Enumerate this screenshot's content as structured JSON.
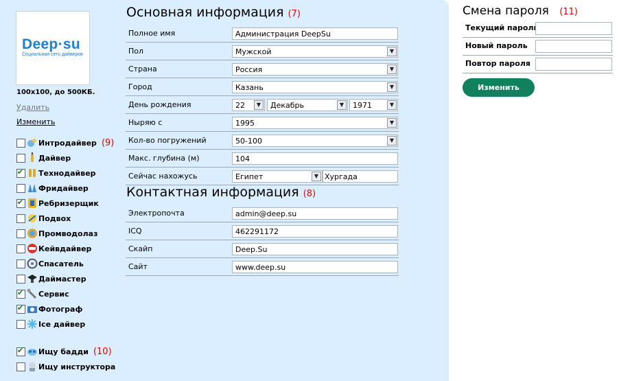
{
  "avatar": {
    "logo_text": "Deep",
    "logo_dot": "·",
    "logo_text2": "su",
    "logo_tagline": "Социальная сеть дайверов",
    "size_note": "100x100, до 500КБ.",
    "delete_label": "Удалить",
    "change_label": "Изменить"
  },
  "specializations": [
    {
      "label": "Интродайвер",
      "checked": false,
      "icon": "intro-diver-icon",
      "mark": "(9)"
    },
    {
      "label": "Дайвер",
      "checked": false,
      "icon": "diver-icon"
    },
    {
      "label": "Технодайвер",
      "checked": true,
      "icon": "tech-diver-icon"
    },
    {
      "label": "Фридайвер",
      "checked": false,
      "icon": "freediver-icon"
    },
    {
      "label": "Ребризерщик",
      "checked": true,
      "icon": "rebreather-icon"
    },
    {
      "label": "Подвох",
      "checked": false,
      "icon": "underwater-hunter-icon"
    },
    {
      "label": "Промводолаз",
      "checked": false,
      "icon": "commercial-diver-icon"
    },
    {
      "label": "Кейвдайвер",
      "checked": false,
      "icon": "cave-diver-icon"
    },
    {
      "label": "Спасатель",
      "checked": false,
      "icon": "rescuer-icon"
    },
    {
      "label": "Даймастер",
      "checked": false,
      "icon": "divemaster-icon"
    },
    {
      "label": "Сервис",
      "checked": true,
      "icon": "service-icon"
    },
    {
      "label": "Фотограф",
      "checked": true,
      "icon": "photographer-icon"
    },
    {
      "label": "Ice дайвер",
      "checked": false,
      "icon": "ice-diver-icon"
    }
  ],
  "seeking": [
    {
      "label": "Ищу бадди",
      "checked": true,
      "icon": "buddy-icon",
      "mark": "(10)"
    },
    {
      "label": "Ищу инструктора",
      "checked": false,
      "icon": "instructor-icon"
    }
  ],
  "basic": {
    "title": "Основная информация",
    "mark": "(7)",
    "full_name_label": "Полное имя",
    "full_name": "Администрация DeepSu",
    "gender_label": "Пол",
    "gender": "Мужской",
    "country_label": "Страна",
    "country": "Россия",
    "city_label": "Город",
    "city": "Казань",
    "birthday_label": "День рождения",
    "birth_day": "22",
    "birth_month": "Декабрь",
    "birth_year": "1971",
    "diving_since_label": "Ныряю с",
    "diving_since": "1995",
    "dives_count_label": "Кол-во погружений",
    "dives_count": "50-100",
    "max_depth_label": "Макс. глубина (м)",
    "max_depth": "104",
    "location_label": "Сейчас нахожусь",
    "location_country": "Египет",
    "location_city": "Хургада"
  },
  "contact": {
    "title": "Контактная информация",
    "mark": "(8)",
    "email_label": "Электропочта",
    "email": "admin@deep.su",
    "icq_label": "ICQ",
    "icq": "462291172",
    "skype_label": "Скайп",
    "skype": "Deep.Su",
    "site_label": "Сайт",
    "site": "www.deep.su"
  },
  "password": {
    "title": "Смена пароля",
    "mark": "(11)",
    "current_label": "Текущий пароль",
    "new_label": "Новый пароль",
    "repeat_label": "Повтор пароля",
    "button": "Изменить"
  },
  "colors": {
    "panel_bg": "#dbeeff",
    "accent_button": "#127f5d",
    "annotation": "#e00000",
    "logo": "#1d7fd0"
  }
}
